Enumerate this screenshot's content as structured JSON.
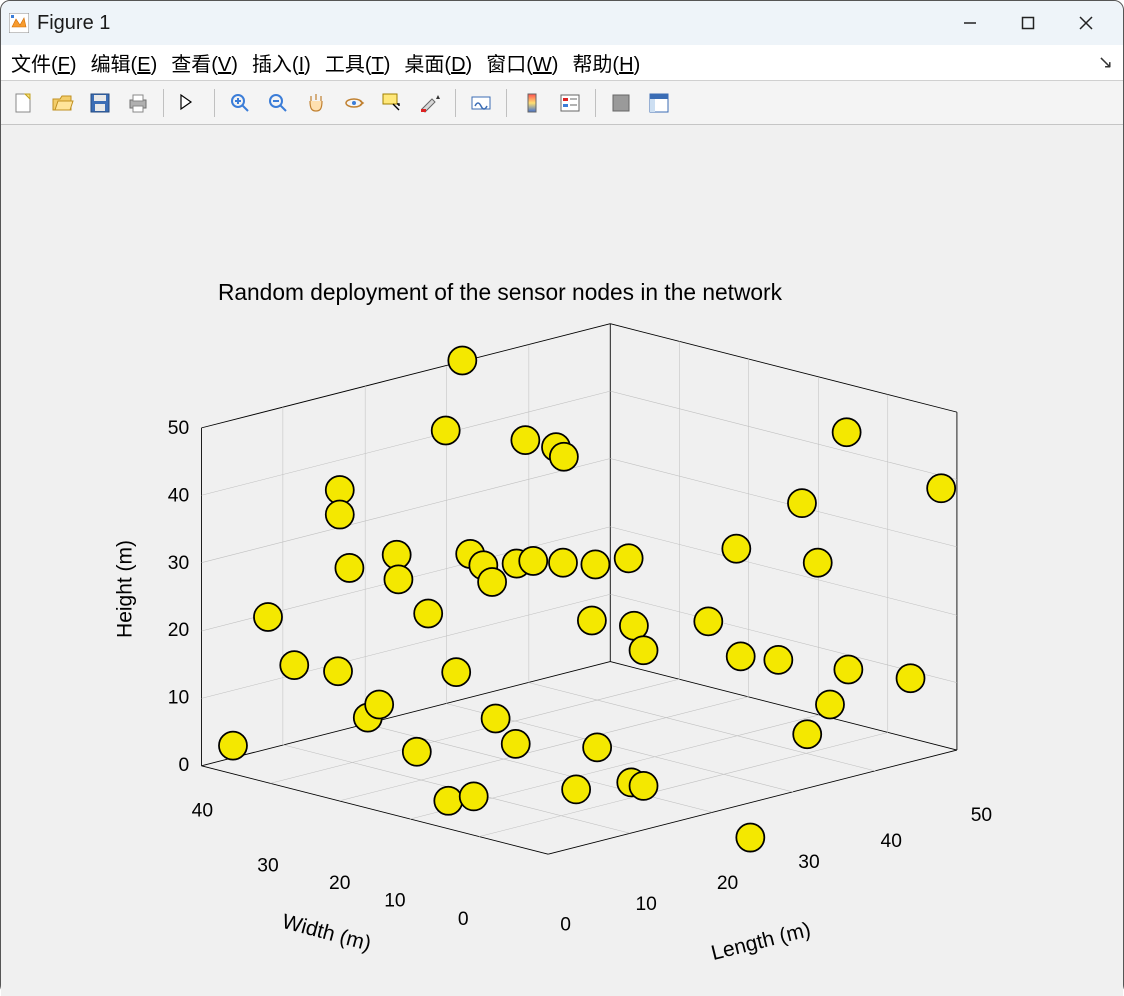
{
  "window": {
    "title": "Figure 1"
  },
  "menu": {
    "file": "文件(F)",
    "edit": "编辑(E)",
    "view": "查看(V)",
    "insert": "插入(I)",
    "tools": "工具(T)",
    "desktop": "桌面(D)",
    "window": "窗口(W)",
    "help": "帮助(H)"
  },
  "chart_data": {
    "type": "scatter",
    "title": "Random deployment of the sensor nodes in the network",
    "xlabel": "Length (m)",
    "ylabel": "Width (m)",
    "zlabel": "Height (m)",
    "xlim": [
      0,
      50
    ],
    "ylim": [
      0,
      50
    ],
    "zlim": [
      0,
      50
    ],
    "xticks": [
      0,
      10,
      20,
      30,
      40,
      50
    ],
    "yticks": [
      0,
      10,
      20,
      30,
      40
    ],
    "zticks": [
      0,
      10,
      20,
      30,
      40,
      50
    ],
    "marker": {
      "shape": "circle",
      "face": "#f4e800",
      "edge": "#000000",
      "size": 16
    },
    "points": [
      {
        "screen": [
          447,
          269
        ],
        "x": 17,
        "y": 45,
        "z": 50
      },
      {
        "screen": [
          428,
          349
        ],
        "x": 13,
        "y": 42,
        "z": 42
      },
      {
        "screen": [
          519,
          360
        ],
        "x": 22,
        "y": 42,
        "z": 42
      },
      {
        "screen": [
          554,
          368
        ],
        "x": 26,
        "y": 43,
        "z": 38
      },
      {
        "screen": [
          563,
          379
        ],
        "x": 25,
        "y": 41,
        "z": 36
      },
      {
        "screen": [
          886,
          351
        ],
        "x": 48,
        "y": 32,
        "z": 45
      },
      {
        "screen": [
          994,
          415
        ],
        "x": 48,
        "y": 10,
        "z": 42
      },
      {
        "screen": [
          835,
          432
        ],
        "x": 45,
        "y": 32,
        "z": 33
      },
      {
        "screen": [
          760,
          484
        ],
        "x": 40,
        "y": 35,
        "z": 27
      },
      {
        "screen": [
          853,
          500
        ],
        "x": 44,
        "y": 22,
        "z": 28
      },
      {
        "screen": [
          637,
          495
        ],
        "x": 32,
        "y": 40,
        "z": 25
      },
      {
        "screen": [
          456,
          490
        ],
        "x": 20,
        "y": 47,
        "z": 24
      },
      {
        "screen": [
          471,
          503
        ],
        "x": 20,
        "y": 44,
        "z": 22
      },
      {
        "screen": [
          509,
          501
        ],
        "x": 23,
        "y": 44,
        "z": 23
      },
      {
        "screen": [
          528,
          498
        ],
        "x": 25,
        "y": 45,
        "z": 24
      },
      {
        "screen": [
          562,
          500
        ],
        "x": 27,
        "y": 43,
        "z": 24
      },
      {
        "screen": [
          481,
          522
        ],
        "x": 20,
        "y": 42,
        "z": 20
      },
      {
        "screen": [
          372,
          491
        ],
        "x": 12,
        "y": 48,
        "z": 23
      },
      {
        "screen": [
          374,
          519
        ],
        "x": 12,
        "y": 46,
        "z": 20
      },
      {
        "screen": [
          318,
          506
        ],
        "x": 7,
        "y": 48,
        "z": 21
      },
      {
        "screen": [
          307,
          417
        ],
        "x": 7,
        "y": 50,
        "z": 33
      },
      {
        "screen": [
          307,
          445
        ],
        "x": 7,
        "y": 50,
        "z": 29
      },
      {
        "screen": [
          408,
          558
        ],
        "x": 12,
        "y": 40,
        "z": 16
      },
      {
        "screen": [
          225,
          562
        ],
        "x": 2,
        "y": 50,
        "z": 14
      },
      {
        "screen": [
          599,
          502
        ],
        "x": 30,
        "y": 44,
        "z": 24
      },
      {
        "screen": [
          595,
          566
        ],
        "x": 28,
        "y": 38,
        "z": 16
      },
      {
        "screen": [
          643,
          572
        ],
        "x": 30,
        "y": 34,
        "z": 16
      },
      {
        "screen": [
          255,
          617
        ],
        "x": 2,
        "y": 44,
        "z": 8
      },
      {
        "screen": [
          305,
          624
        ],
        "x": 5,
        "y": 40,
        "z": 7
      },
      {
        "screen": [
          765,
          607
        ],
        "x": 38,
        "y": 25,
        "z": 14
      },
      {
        "screen": [
          808,
          611
        ],
        "x": 42,
        "y": 25,
        "z": 15
      },
      {
        "screen": [
          728,
          567
        ],
        "x": 36,
        "y": 32,
        "z": 18
      },
      {
        "screen": [
          654,
          600
        ],
        "x": 30,
        "y": 30,
        "z": 13
      },
      {
        "screen": [
          888,
          622
        ],
        "x": 45,
        "y": 16,
        "z": 15
      },
      {
        "screen": [
          959,
          632
        ],
        "x": 48,
        "y": 6,
        "z": 16
      },
      {
        "screen": [
          867,
          662
        ],
        "x": 42,
        "y": 14,
        "z": 10
      },
      {
        "screen": [
          841,
          696
        ],
        "x": 38,
        "y": 10,
        "z": 5
      },
      {
        "screen": [
          185,
          709
        ],
        "x": 0,
        "y": 45,
        "z": 0
      },
      {
        "screen": [
          339,
          677
        ],
        "x": 6,
        "y": 35,
        "z": 2
      },
      {
        "screen": [
          352,
          662
        ],
        "x": 8,
        "y": 36,
        "z": 4
      },
      {
        "screen": [
          440,
          625
        ],
        "x": 15,
        "y": 38,
        "z": 9
      },
      {
        "screen": [
          485,
          678
        ],
        "x": 16,
        "y": 28,
        "z": 3
      },
      {
        "screen": [
          395,
          716
        ],
        "x": 8,
        "y": 30,
        "z": 0
      },
      {
        "screen": [
          431,
          772
        ],
        "x": 8,
        "y": 20,
        "z": 0
      },
      {
        "screen": [
          460,
          767
        ],
        "x": 10,
        "y": 20,
        "z": 0
      },
      {
        "screen": [
          577,
          759
        ],
        "x": 18,
        "y": 18,
        "z": 0
      },
      {
        "screen": [
          508,
          707
        ],
        "x": 15,
        "y": 25,
        "z": 0
      },
      {
        "screen": [
          601,
          711
        ],
        "x": 22,
        "y": 24,
        "z": 2
      },
      {
        "screen": [
          640,
          751
        ],
        "x": 22,
        "y": 15,
        "z": 0
      },
      {
        "screen": [
          654,
          755
        ],
        "x": 23,
        "y": 14,
        "z": 0
      },
      {
        "screen": [
          776,
          814
        ],
        "x": 28,
        "y": 0,
        "z": 0
      }
    ]
  }
}
